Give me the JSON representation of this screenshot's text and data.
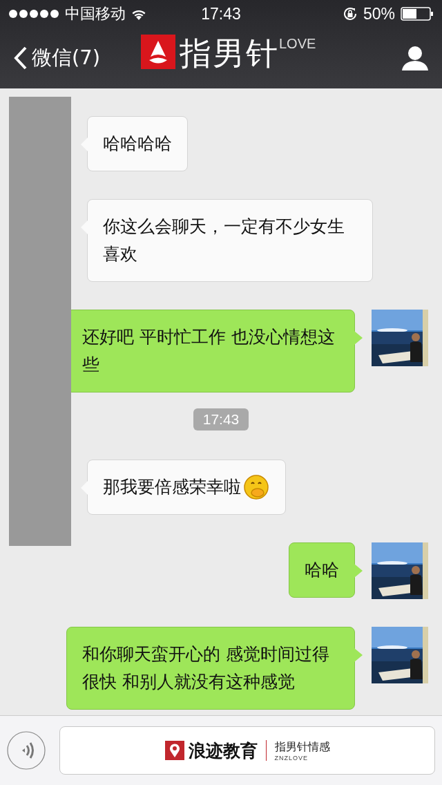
{
  "status_bar": {
    "carrier": "中国移动",
    "time": "17:43",
    "battery": "50%"
  },
  "nav": {
    "back_label": "微信(7)",
    "logo_text": "指男针",
    "logo_sup": "LOVE"
  },
  "messages": [
    {
      "kind": "received",
      "text": "哈哈哈哈"
    },
    {
      "kind": "received",
      "text": "你这么会聊天，一定有不少女生喜欢"
    },
    {
      "kind": "sent",
      "text": "还好吧 平时忙工作 也没心情想这些"
    },
    {
      "kind": "time",
      "text": "17:43"
    },
    {
      "kind": "received",
      "text": "那我要倍感荣幸啦",
      "emoji": true
    },
    {
      "kind": "sent",
      "text": "哈哈"
    },
    {
      "kind": "sent",
      "text": "和你聊天蛮开心的 感觉时间过得很快 和别人就没有这种感觉"
    }
  ],
  "input_bar": {
    "brand": "浪迹教育",
    "sub_brand": "指男针情感",
    "sub_brand_en": "ZNZLOVE"
  }
}
